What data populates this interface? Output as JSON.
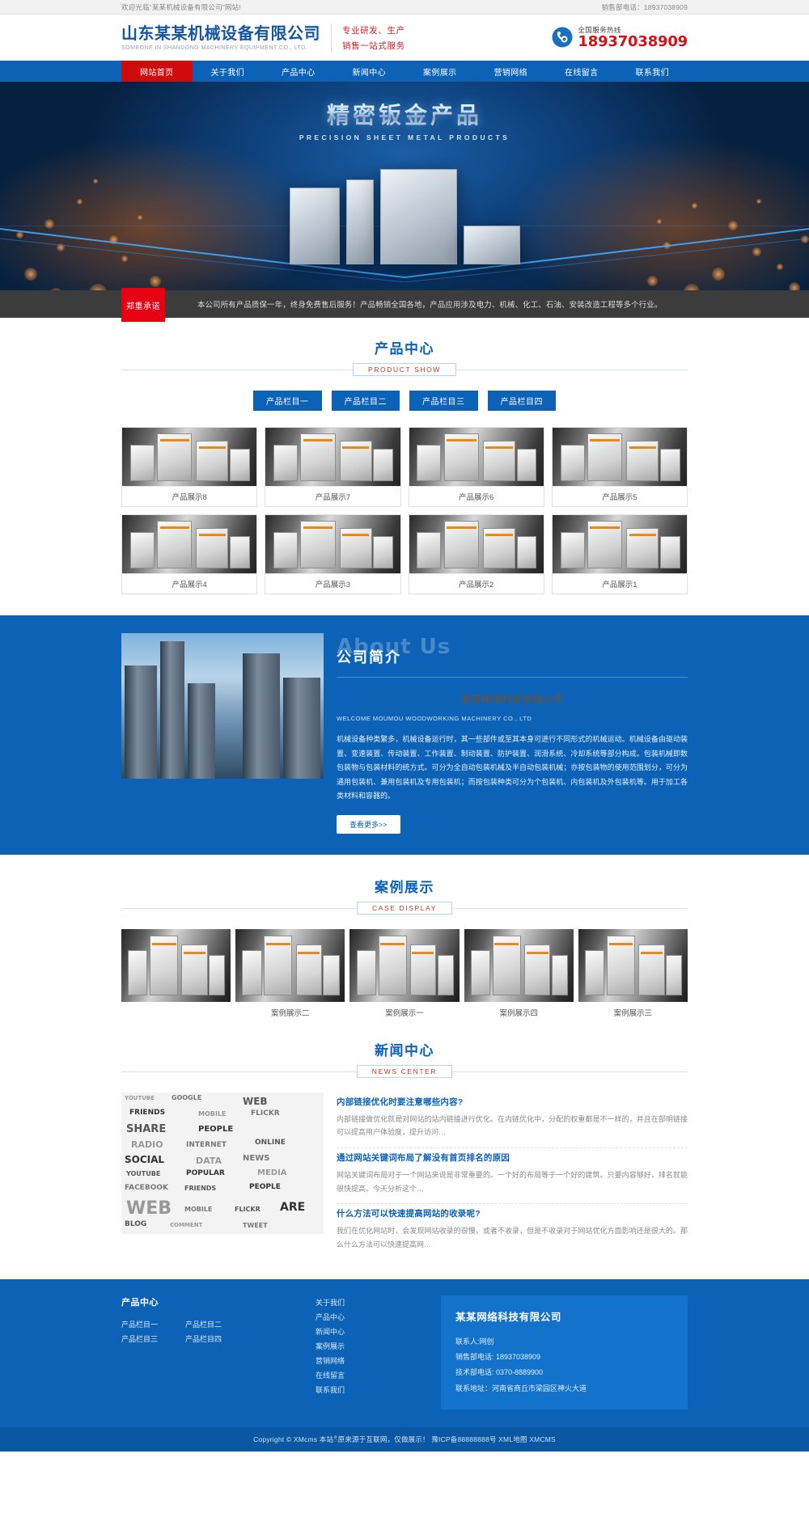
{
  "topbar": {
    "welcome": "欢迎光临“某某机械设备有限公司”网站!",
    "sales_tel": "销售部电话：18937038909"
  },
  "header": {
    "logo_cn": "山东某某机械设备有限公司",
    "logo_en": "SOMEONE IN SHANDONG MACHINERY EQUIPMENT CO., LTD.",
    "slogan_line1": "专业研发、生产",
    "slogan_line2": "销售一站式服务",
    "tel_label": "全国服务热线",
    "tel_number": "18937038909",
    "phone_icon": "telephone-icon"
  },
  "nav": {
    "items": [
      {
        "label": "网站首页",
        "active": true
      },
      {
        "label": "关于我们",
        "active": false
      },
      {
        "label": "产品中心",
        "active": false
      },
      {
        "label": "新闻中心",
        "active": false
      },
      {
        "label": "案例展示",
        "active": false
      },
      {
        "label": "营销网络",
        "active": false
      },
      {
        "label": "在线留言",
        "active": false
      },
      {
        "label": "联系我们",
        "active": false
      }
    ]
  },
  "banner": {
    "title_cn": "精密钣金产品",
    "title_en": "PRECISION SHEET METAL PRODUCTS"
  },
  "notice": {
    "tag": "郑重承诺",
    "text": "本公司所有产品质保一年，终身免费售后服务！产品畅销全国各地，产品应用涉及电力、机械、化工、石油、安装改造工程等多个行业。"
  },
  "products": {
    "title_cn": "产品中心",
    "title_en": "PRODUCT SHOW",
    "categories": [
      "产品栏目一",
      "产品栏目二",
      "产品栏目三",
      "产品栏目四"
    ],
    "items": [
      {
        "name": "产品展示8"
      },
      {
        "name": "产品展示7"
      },
      {
        "name": "产品展示6"
      },
      {
        "name": "产品展示5"
      },
      {
        "name": "产品展示4"
      },
      {
        "name": "产品展示3"
      },
      {
        "name": "产品展示2"
      },
      {
        "name": "产品展示1"
      }
    ]
  },
  "about": {
    "title_en": "About Us",
    "title_cn": "公司简介",
    "company_cn": "某某网络科技有限公司",
    "company_en": "WELCOME MOUMOU WOODWORKING MACHINERY CO., LTD",
    "desc": "机械设备种类繁多，机械设备运行时，其一些部件或至其本身可进行不同形式的机械运动。机械设备由驱动装置、变速装置、传动装置、工作装置、制动装置、防护装置、润滑系统、冷却系统等部分构成。包装机械即数包装物与包装材料的统方式。可分为全自动包装机械及半自动包装机械；亦按包装物的使用范围划分，可分为通用包装机、兼用包装机及专用包装机；而按包装种类可分为个包装机、内包装机及外包装机等。用于加工各类材料和容器的。",
    "more_label": "查看更多>>"
  },
  "cases": {
    "title_cn": "案例展示",
    "title_en": "CASE DISPLAY",
    "items": [
      {
        "name": ""
      },
      {
        "name": "案例展示二"
      },
      {
        "name": "案例展示一"
      },
      {
        "name": "案例展示四"
      },
      {
        "name": "案例展示三"
      }
    ]
  },
  "news": {
    "title_cn": "新闻中心",
    "title_en": "NEWS CENTER",
    "items": [
      {
        "title": "内部链接优化时要注意哪些内容?",
        "desc": "内部链接做优化就是对网站的站内链接进行优化。在内链优化中，分配的权重都是不一样的，并且在部明链接可以提高用户体验度，提升访问…"
      },
      {
        "title": "通过网站关键词布局了解没有首页排名的原因",
        "desc": "网站关键词布局对于一个网站来说是非常重要的。一个好的布局等于一个好的建筑。只要内容够好，排名就能很快提高。今天分析这个…"
      },
      {
        "title": "什么方法可以快速提高网站的收录呢?",
        "desc": "我们在优化网站时，会发现网站收录的很慢，或者不收录，但是不收录对于网站优化方面影响还是很大的。那么什么方法可以快速提高网…"
      }
    ]
  },
  "footer": {
    "col1_title": "产品中心",
    "col1_links_left": [
      "产品栏目一",
      "产品栏目三"
    ],
    "col1_links_right": [
      "产品栏目二",
      "产品栏目四"
    ],
    "col2_links": [
      "关于我们",
      "产品中心",
      "新闻中心",
      "案例展示",
      "营销网络",
      "在线留言",
      "联系我们"
    ],
    "col3_title": "某某网络科技有限公司",
    "col3_lines": [
      "联系人:网创",
      "销售部电话: 18937038909",
      "技术部电话: 0370-8889900",
      "联系地址：河南省商丘市梁园区神火大道"
    ]
  },
  "copyright": {
    "text": "Copyright © XMcms 本站ီ原来源于互联网，仅做展示！  豫ICP备88888888号  XML地图  XMCMS"
  },
  "colors": {
    "brand_blue": "#0b62b7",
    "accent_red": "#d00b0b",
    "notice_red": "#e60012",
    "dark_bar": "#3c3c3c"
  }
}
